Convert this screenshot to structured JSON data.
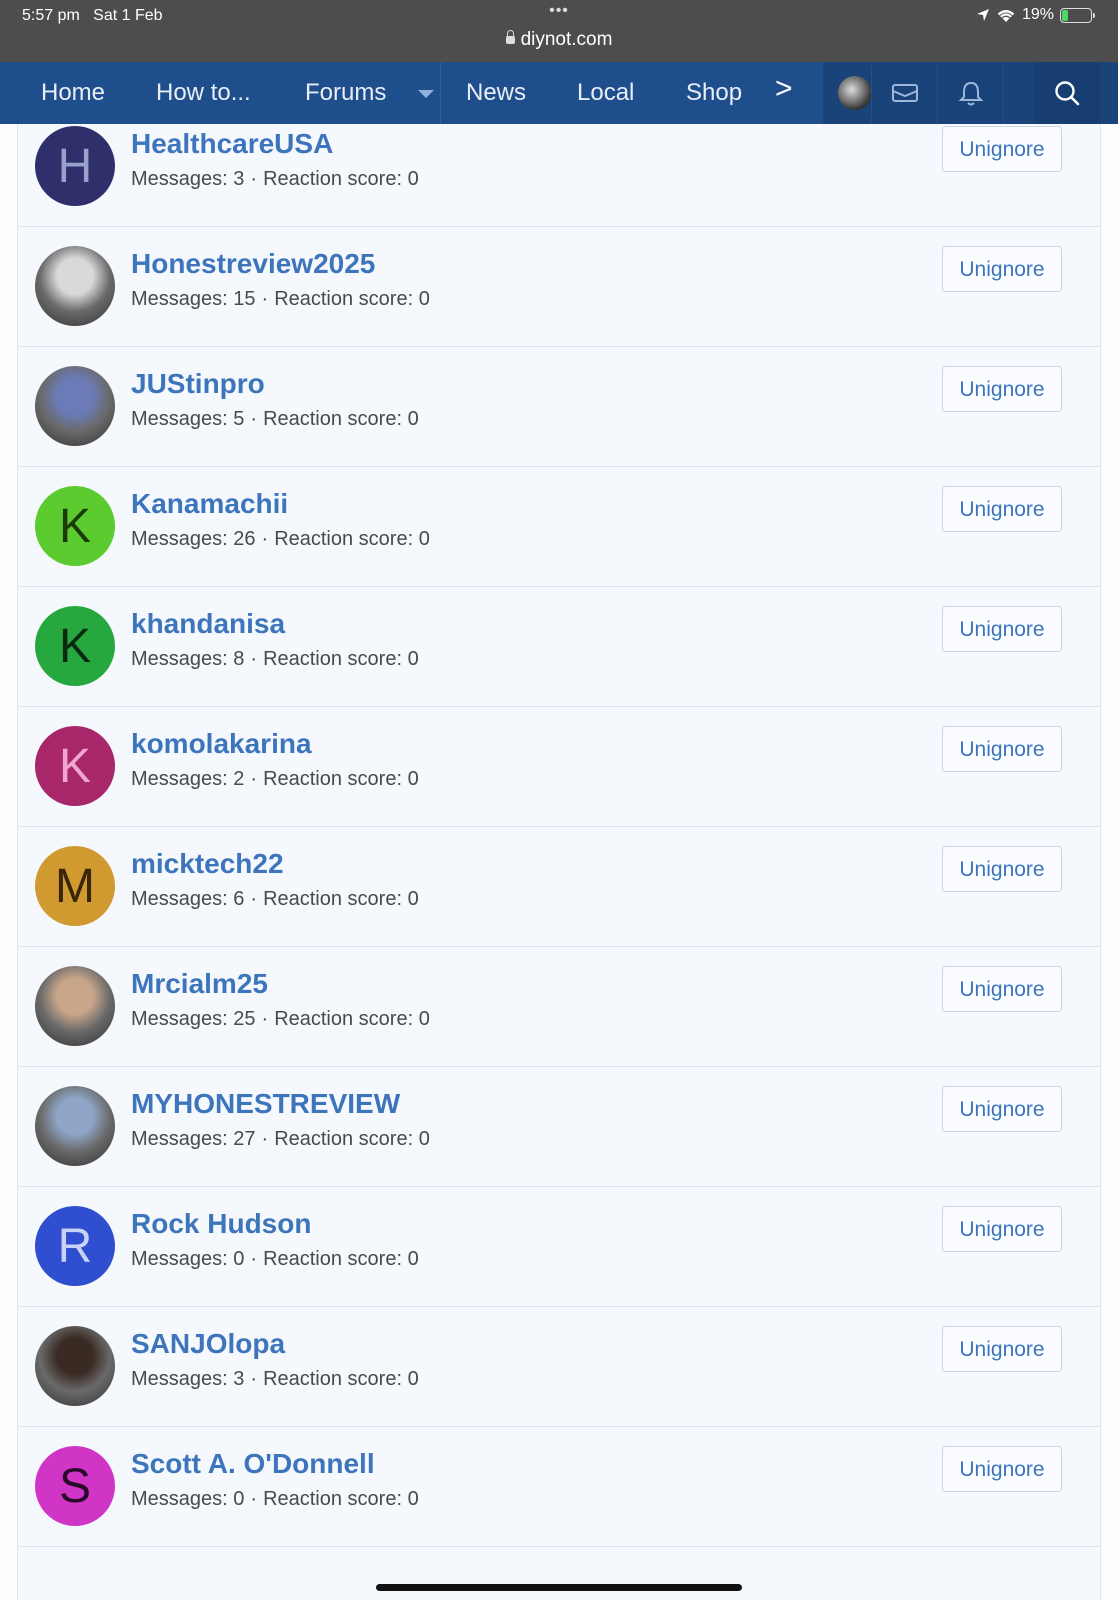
{
  "status_bar": {
    "time": "5:57 pm",
    "date": "Sat 1 Feb",
    "dots": "•••",
    "url": "diynot.com",
    "battery": "19%"
  },
  "nav": {
    "items": [
      "Home",
      "How to...",
      "Forums",
      "News",
      "Local",
      "Shop"
    ],
    "more": ">"
  },
  "users": [
    {
      "name": "HealthcareUSA",
      "messages": "Messages: 3",
      "reaction": "Reaction score: 0",
      "letter": "H",
      "color": "#2e2f6b",
      "letter_color": "#9aa0cc",
      "photo": false
    },
    {
      "name": "Honestreview2025",
      "messages": "Messages: 15",
      "reaction": "Reaction score: 0",
      "letter": "",
      "color": "#d9d9d9",
      "photo": true
    },
    {
      "name": "JUStinpro",
      "messages": "Messages: 5",
      "reaction": "Reaction score: 0",
      "letter": "",
      "color": "#6b7bb7",
      "photo": true
    },
    {
      "name": "Kanamachii",
      "messages": "Messages: 26",
      "reaction": "Reaction score: 0",
      "letter": "K",
      "color": "#5ccb2f",
      "letter_color": "#1b3a0a",
      "photo": false
    },
    {
      "name": "khandanisa",
      "messages": "Messages: 8",
      "reaction": "Reaction score: 0",
      "letter": "K",
      "color": "#27a83f",
      "letter_color": "#0a2a10",
      "photo": false
    },
    {
      "name": "komolakarina",
      "messages": "Messages: 2",
      "reaction": "Reaction score: 0",
      "letter": "K",
      "color": "#a8266a",
      "letter_color": "#f0a6cf",
      "photo": false
    },
    {
      "name": "micktech22",
      "messages": "Messages: 6",
      "reaction": "Reaction score: 0",
      "letter": "M",
      "color": "#d09a30",
      "letter_color": "#3a2506",
      "photo": false
    },
    {
      "name": "Mrcialm25",
      "messages": "Messages: 25",
      "reaction": "Reaction score: 0",
      "letter": "",
      "color": "#c9a68a",
      "photo": true
    },
    {
      "name": "MYHONESTREVIEW",
      "messages": "Messages: 27",
      "reaction": "Reaction score: 0",
      "letter": "",
      "color": "#8fa6c8",
      "photo": true
    },
    {
      "name": "Rock Hudson",
      "messages": "Messages: 0",
      "reaction": "Reaction score: 0",
      "letter": "R",
      "color": "#2f4fd0",
      "letter_color": "#c8d2f6",
      "photo": false
    },
    {
      "name": "SANJOlopa",
      "messages": "Messages: 3",
      "reaction": "Reaction score: 0",
      "letter": "",
      "color": "#3a2a24",
      "photo": true
    },
    {
      "name": "Scott A. O'Donnell",
      "messages": "Messages: 0",
      "reaction": "Reaction score: 0",
      "letter": "S",
      "color": "#d035c6",
      "letter_color": "#2a0a28",
      "photo": false
    }
  ],
  "button_label": "Unignore"
}
